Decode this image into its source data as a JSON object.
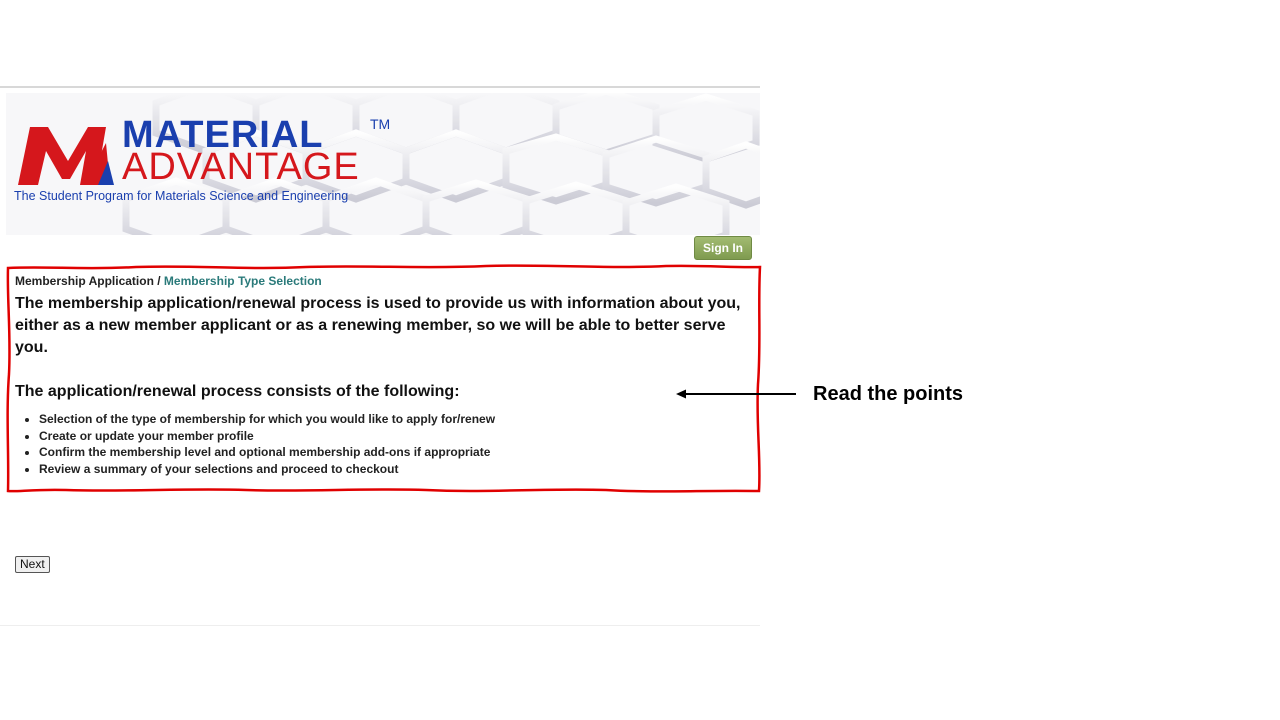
{
  "banner": {
    "logo_word1": "MATERIAL",
    "logo_tm": "TM",
    "logo_word2": "ADVANTAGE",
    "tagline": "The Student Program for Materials Science and Engineering",
    "brand_blue": "#1a3fae",
    "brand_red": "#d5171c"
  },
  "header": {
    "signin_label": "Sign In"
  },
  "breadcrumb": {
    "root": "Membership Application",
    "separator": " / ",
    "current": "Membership Type Selection"
  },
  "main": {
    "intro": "The membership application/renewal process is used to provide us with information about you, either as a new member applicant or as a renewing member, so we will be able to better serve you.",
    "subheading": "The application/renewal process consists of the following:",
    "steps": [
      "Selection of the type of membership for which you would like to apply for/renew",
      "Create or update your member profile",
      "Confirm the membership level and optional membership add-ons if appropriate",
      "Review a summary of your selections and proceed to checkout"
    ]
  },
  "footer": {
    "next_label": "Next"
  },
  "annotation": {
    "text": "Read the points",
    "highlight_color": "#e00000"
  }
}
